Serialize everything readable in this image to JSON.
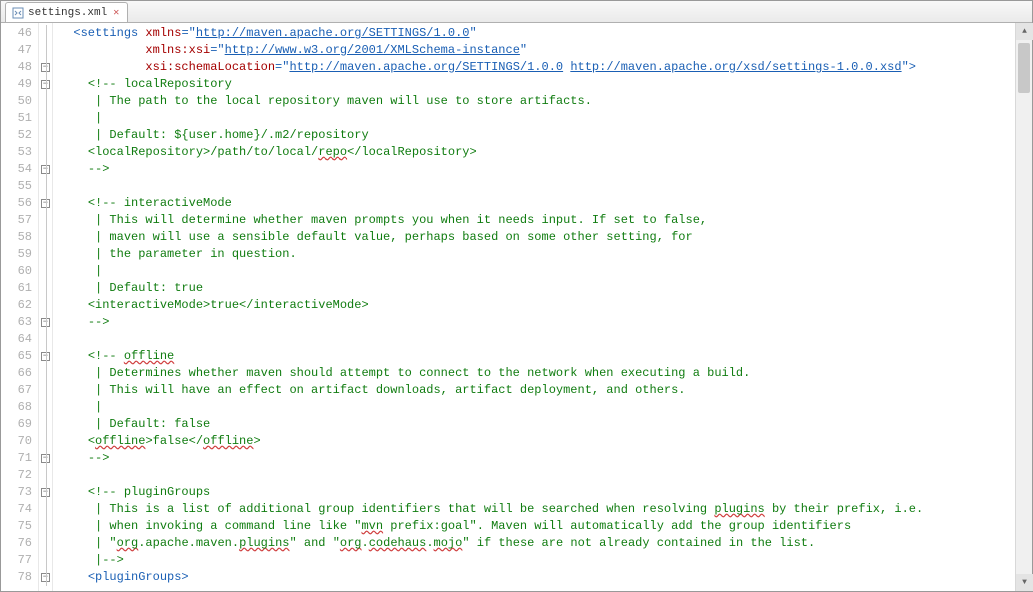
{
  "tab": {
    "label": "settings.xml"
  },
  "gutter": {
    "start": 46,
    "end": 78
  },
  "code": {
    "l46": {
      "p1": "<settings ",
      "a1": "xmlns",
      "eq": "=\"",
      "u1": "http://maven.apache.org/SETTINGS/1.0.0",
      "q": "\""
    },
    "l47": {
      "a1": "xmlns:xsi",
      "eq": "=\"",
      "u1": "http://www.w3.org/2001/XMLSchema-instance",
      "q": "\""
    },
    "l48": {
      "a1": "xsi:schemaLocation",
      "eq": "=\"",
      "u1": "http://maven.apache.org/SETTINGS/1.0.0",
      "sp": " ",
      "u2": "http://maven.apache.org/xsd/settings-1.0.0.xsd",
      "end": "\">"
    },
    "l49": "<!-- localRepository",
    "l50": " | The path to the local repository maven will use to store artifacts.",
    "l51": " |",
    "l52": " | Default: ${user.home}/.m2/repository",
    "l53": {
      "open": "<localRepository>",
      "t1": "/path/to/local/",
      "sp": "repo",
      "close": "</localRepository>"
    },
    "l54": "-->",
    "l56": "<!-- interactiveMode",
    "l57": " | This will determine whether maven prompts you when it needs input. If set to false,",
    "l58": " | maven will use a sensible default value, perhaps based on some other setting, for",
    "l59": " | the parameter in question.",
    "l60": " |",
    "l61": " | Default: true",
    "l62": {
      "open": "<interactiveMode>",
      "val": "true",
      "close": "</interactiveMode>"
    },
    "l63": "-->",
    "l65": {
      "p1": "<!-- ",
      "sp": "offline"
    },
    "l66": " | Determines whether maven should attempt to connect to the network when executing a build.",
    "l67": " | This will have an effect on artifact downloads, artifact deployment, and others.",
    "l68": " |",
    "l69": " | Default: false",
    "l70": {
      "o1": "<",
      "t1": "offline",
      "o2": ">",
      "val": "false",
      "c1": "</",
      "t2": "offline",
      "c2": ">"
    },
    "l71": "-->",
    "l73": "<!-- pluginGroups",
    "l74": {
      "p1": " | This is a list of additional group identifiers that will be searched when resolving ",
      "sp": "plugins",
      "p2": " by their prefix, i.e."
    },
    "l75": {
      "p1": " | when invoking a command line like \"",
      "sp": "mvn",
      "p2": " prefix:goal\". Maven will automatically add the group identifiers"
    },
    "l76": {
      "p1": " | \"",
      "s1": "org",
      "p2": ".apache.maven.",
      "s2": "plugins",
      "p3": "\" and \"",
      "s3": "org",
      "p4": ".",
      "s4": "codehaus",
      "p5": ".",
      "s5": "mojo",
      "p6": "\" if these are not already contained in the list."
    },
    "l77": " |-->",
    "l78": "<pluginGroups>"
  }
}
